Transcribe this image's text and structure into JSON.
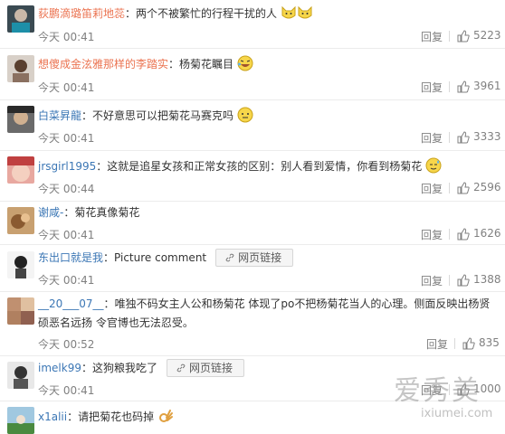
{
  "comments": [
    {
      "name": "荻鹏滴璐笛莉地蕊",
      "sep": "：",
      "text": "两个不被繁忙的行程干扰的人",
      "time": "今天 00:41",
      "reply": "回复",
      "likes": "5223"
    },
    {
      "name": "想傻成金泫雅那样的李踏实",
      "sep": "：",
      "text": "杨菊花瞩目",
      "time": "今天 00:41",
      "reply": "回复",
      "likes": "3961"
    },
    {
      "name": "白菜昇龍",
      "sep": "：",
      "text": "不好意思可以把菊花马赛克吗",
      "time": "今天 00:41",
      "reply": "回复",
      "likes": "3333"
    },
    {
      "name": "jrsgirl1995",
      "sep": "：",
      "text": "这就是追星女孩和正常女孩的区别：别人看到爱情，你看到杨菊花",
      "time": "今天 00:44",
      "reply": "回复",
      "likes": "2596"
    },
    {
      "name": "谢咸-",
      "sep": "：",
      "text": "菊花真像菊花",
      "time": "今天 00:41",
      "reply": "回复",
      "likes": "1626"
    },
    {
      "name": "东出口就是我",
      "sep": "：",
      "text": "Picture comment",
      "link": "网页链接",
      "time": "今天 00:41",
      "reply": "回复",
      "likes": "1388"
    },
    {
      "name": "__20___07__",
      "sep": "：",
      "text": "唯独不码女主人公和杨菊花 体现了po不把杨菊花当人的心理。侧面反映出杨贤硕恶名远扬 令官博也无法忍受。",
      "time": "今天 00:52",
      "reply": "回复",
      "likes": "835"
    },
    {
      "name": "imelk99",
      "sep": "：",
      "text": "这狗粮我吃了",
      "link": "网页链接",
      "time": "今天 00:41",
      "reply": "回复",
      "likes": "1000"
    },
    {
      "name": "x1alii",
      "sep": "：",
      "text": "请把菊花也码掉"
    }
  ],
  "watermark": {
    "main": "爱秀美",
    "sub": "ixiumei.com"
  },
  "colors": {
    "name": "#eb7350",
    "link": "#3c77b5",
    "meta": "#808080"
  }
}
